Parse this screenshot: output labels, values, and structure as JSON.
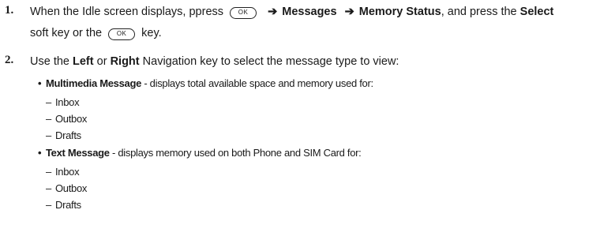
{
  "steps": [
    {
      "number": "1.",
      "line1_a": "When the Idle screen displays, ppress",
      "key_label": "OK",
      "arrow": "➔",
      "menu1": "Messages",
      "menu2": "Memory Status",
      "line1_b": ", and press the",
      "select_label": "Select",
      "line2_a": "soft key or the",
      "line2_b": "key."
    },
    {
      "number": "2.",
      "text_a": "Use the",
      "left": "Left",
      "or": "or",
      "right": "Right",
      "text_b": "Navigation key to select the message type to view:"
    }
  ],
  "bullets": [
    {
      "title": "Multimedia Message",
      "desc": " - displays total available space and memory used for:",
      "items": [
        "Inbox",
        "Outbox",
        "Drafts"
      ]
    },
    {
      "title": "Text Message",
      "desc": " - displays memory used on both Phone and SIM Card for:",
      "items": [
        "Inbox",
        "Outbox",
        "Drafts"
      ]
    }
  ]
}
